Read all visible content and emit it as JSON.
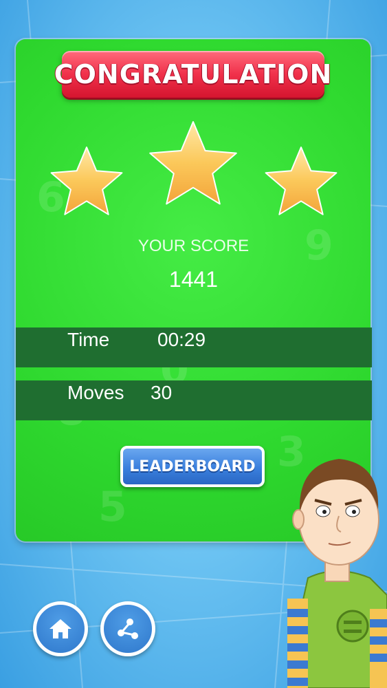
{
  "header": {
    "title": "CONGRATULATION"
  },
  "rating": {
    "stars_earned": 3,
    "stars_total": 3
  },
  "score": {
    "label": "YOUR SCORE",
    "value": "1441"
  },
  "stats": [
    {
      "label": "Time",
      "value": "00:29"
    },
    {
      "label": "Moves",
      "value": "30"
    }
  ],
  "buttons": {
    "leaderboard": "LEADERBOARD",
    "home_icon": "home-icon",
    "share_icon": "share-icon"
  },
  "colors": {
    "card_green": "#2fd92f",
    "banner_red": "#f0304a",
    "button_blue": "#3a7fdd",
    "star_gold": "#fbc85a",
    "stat_band": "#1f6e30"
  }
}
